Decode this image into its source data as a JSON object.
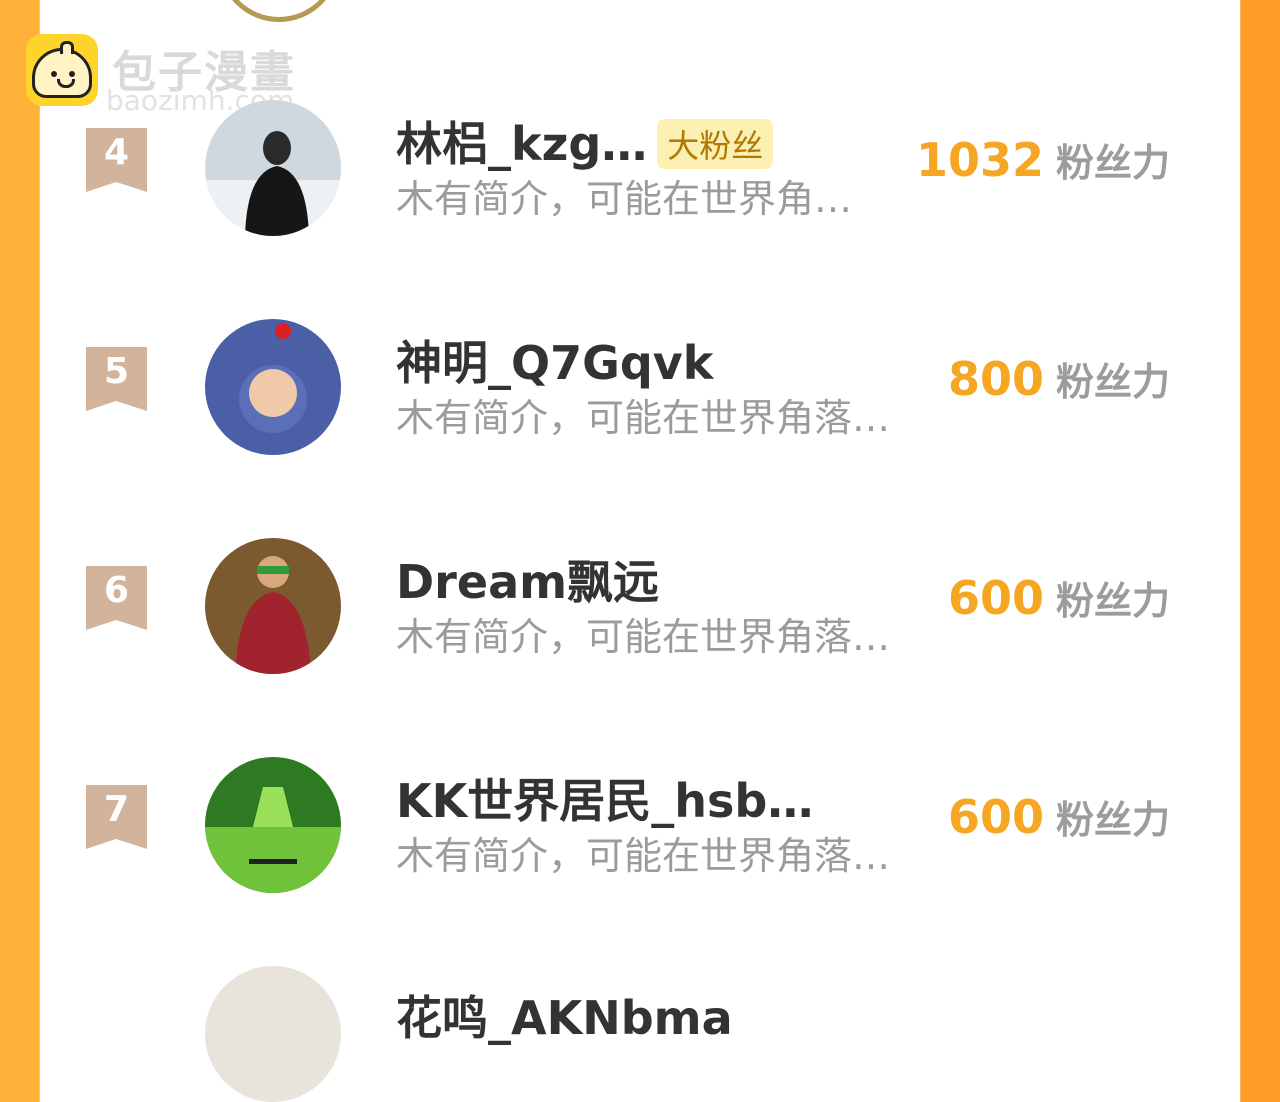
{
  "watermark": {
    "title": "包子漫畫",
    "url": "baozimh.com"
  },
  "score_unit": "粉丝力",
  "entries": [
    {
      "rank": "4",
      "name": "林梠_kzg…",
      "badge": "大粉丝",
      "bio": "木有简介，可能在世界角…",
      "score": "1032"
    },
    {
      "rank": "5",
      "name": "神明_Q7Gqvk",
      "bio": "木有简介，可能在世界角落…",
      "score": "800"
    },
    {
      "rank": "6",
      "name": "Dream飘远",
      "bio": "木有简介，可能在世界角落…",
      "score": "600"
    },
    {
      "rank": "7",
      "name": "KK世界居民_hsb…",
      "bio": "木有简介，可能在世界角落…",
      "score": "600"
    }
  ],
  "partial_next": {
    "name": "花鸣_AKNbma"
  },
  "colors": {
    "accent": "#f5a623",
    "sidebar_left": "#ffb23a",
    "sidebar_right": "#ff9c2a",
    "badge_bg": "#fbefb1"
  }
}
